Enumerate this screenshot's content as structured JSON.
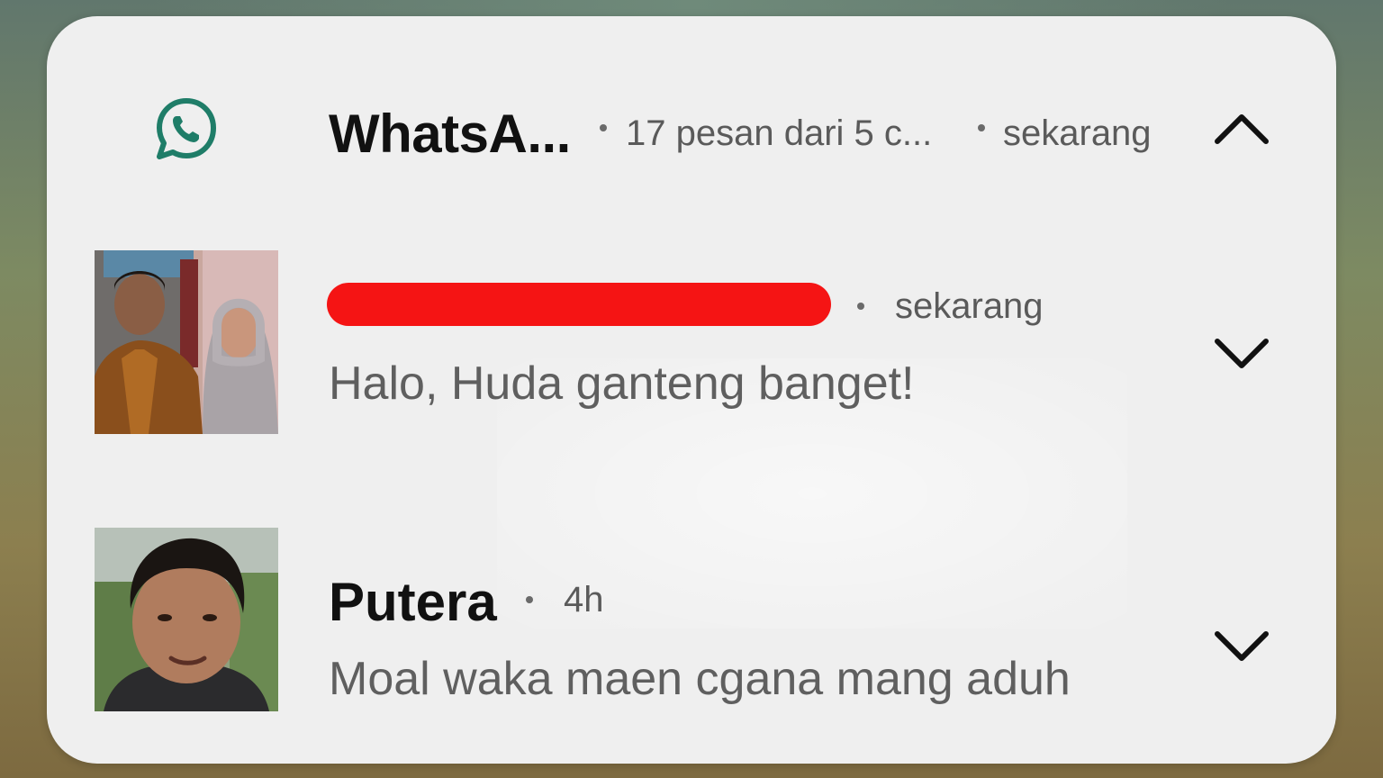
{
  "notification_group": {
    "app_name": "WhatsA...",
    "summary": "17 pesan dari 5 c...",
    "time": "sekarang",
    "brand_color": "#1f7d68",
    "expand_icon": "chevron-up-icon"
  },
  "messages": [
    {
      "sender": "",
      "sender_redacted": true,
      "time": "sekarang",
      "text": "Halo, Huda ganteng banget!",
      "expand_icon": "chevron-down-icon",
      "avatar": "photo-of-two-people"
    },
    {
      "sender": "Putera",
      "sender_redacted": false,
      "time": "4h",
      "text": "Moal waka maen cgana mang aduh",
      "expand_icon": "chevron-down-icon",
      "avatar": "photo-of-young-man"
    }
  ],
  "colors": {
    "card_background": "#efefef",
    "redaction": "#f51414",
    "primary_text": "#111111",
    "secondary_text": "#5f5f5f"
  }
}
